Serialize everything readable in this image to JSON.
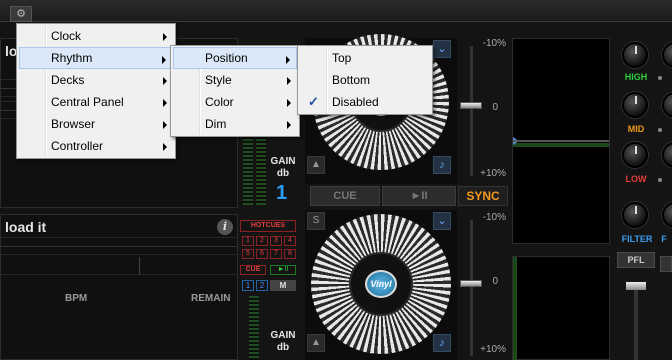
{
  "app": {
    "deck_a_title": "lo",
    "deck_b_title": "load it",
    "info_icon": "i",
    "gear_icon": "⚙",
    "bpm_label": "BPM",
    "remain_label": "REMAIN",
    "gain_label_a": "GAIN",
    "db_label_a": "db",
    "deck_num_a": "1",
    "gain_label_b": "GAIN",
    "db_label_b": "db",
    "hotcues_label": "HOTCUES",
    "hotcue_numbers": [
      "1",
      "2",
      "3",
      "4",
      "5",
      "6",
      "7",
      "8"
    ],
    "cue_small": "CUE",
    "play_small": "►II",
    "small_one": "1",
    "small_two": "2",
    "small_m": "M",
    "cue_button": "CUE",
    "play_button": "►II",
    "sync_button": "SYNC",
    "pitch_top_a": "-10%",
    "pitch_zero_a": "0",
    "pitch_bottom_a": "+10%",
    "pitch_top_b": "-10%",
    "pitch_zero_b": "0",
    "pitch_bottom_b": "+10%",
    "vinyl_label": "Vinyl",
    "s_label": "S",
    "eq": {
      "high": "HIGH",
      "mid": "MID",
      "low": "LOW",
      "filter": "FILTER",
      "filter_cut": "F",
      "high_color": "#2ecc40",
      "mid_color": "#f39a1d",
      "low_color": "#e53935",
      "filter_color": "#3a9df0"
    },
    "pfl_button": "PFL",
    "music_note_icon": "♪"
  },
  "menus": {
    "main": [
      {
        "label": "Clock"
      },
      {
        "label": "Rhythm"
      },
      {
        "label": "Decks"
      },
      {
        "label": "Central Panel"
      },
      {
        "label": "Browser"
      },
      {
        "label": "Controller"
      }
    ],
    "rhythm": [
      {
        "label": "Position"
      },
      {
        "label": "Style"
      },
      {
        "label": "Color"
      },
      {
        "label": "Dim"
      }
    ],
    "position": [
      {
        "label": "Top"
      },
      {
        "label": "Bottom"
      },
      {
        "label": "Disabled",
        "checked": true
      }
    ],
    "check_mark": "✓"
  }
}
